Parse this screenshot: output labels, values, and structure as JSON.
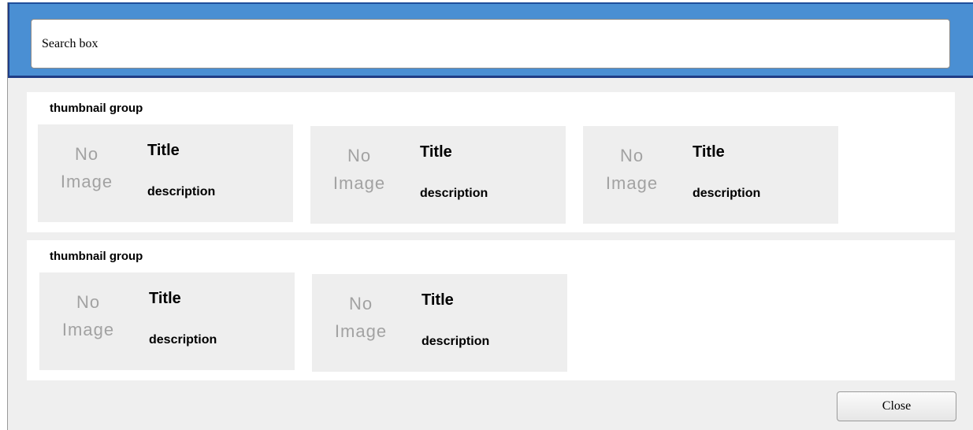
{
  "search": {
    "placeholder": "Search box"
  },
  "groups": [
    {
      "label": "thumbnail group",
      "items": [
        {
          "image_line1": "No",
          "image_line2": "Image",
          "title": "Title",
          "description": "description"
        },
        {
          "image_line1": "No",
          "image_line2": "Image",
          "title": "Title",
          "description": "description"
        },
        {
          "image_line1": "No",
          "image_line2": "Image",
          "title": "Title",
          "description": "description"
        }
      ]
    },
    {
      "label": "thumbnail group",
      "items": [
        {
          "image_line1": "No",
          "image_line2": "Image",
          "title": "Title",
          "description": "description"
        },
        {
          "image_line1": "No",
          "image_line2": "Image",
          "title": "Title",
          "description": "description"
        }
      ]
    }
  ],
  "footer": {
    "close_label": "Close"
  },
  "colors": {
    "header": "#4a8fd3",
    "header_border": "#1f3d86",
    "dialog_bg": "#efefef",
    "thumb_bg": "#eeeeee",
    "placeholder_text": "#a2a2a2"
  }
}
